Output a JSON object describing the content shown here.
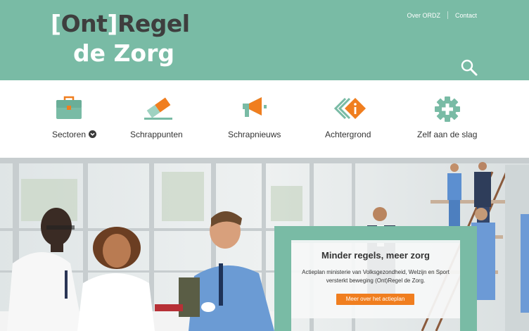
{
  "header": {
    "logo": {
      "bracket_open": "[",
      "ont": "Ont",
      "bracket_close": "]",
      "regel": "Regel",
      "line2": "de Zorg"
    },
    "links": [
      "Over ORDZ",
      "Contact"
    ]
  },
  "nav": {
    "items": [
      {
        "label": "Sectoren",
        "icon": "briefcase-icon"
      },
      {
        "label": "Schrappunten",
        "icon": "eraser-icon"
      },
      {
        "label": "Schrapnieuws",
        "icon": "megaphone-icon"
      },
      {
        "label": "Achtergrond",
        "icon": "info-layers-icon"
      },
      {
        "label": "Zelf aan de slag",
        "icon": "plus-gear-icon"
      }
    ]
  },
  "hero": {
    "title": "Minder regels, meer zorg",
    "text": "Actieplan ministerie van Volksgezondheid, Welzijn en Sport versterkt beweging (Ont)Regel de Zorg.",
    "button": "Meer over het actieplan"
  },
  "colors": {
    "brand_green": "#79bba5",
    "accent_orange": "#f07e1f",
    "dark_text": "#333333"
  }
}
